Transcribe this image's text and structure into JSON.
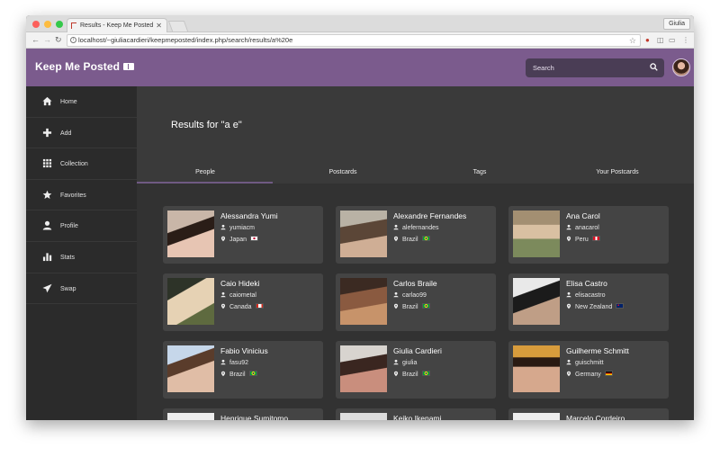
{
  "browser": {
    "tab_title": "Results - Keep Me Posted",
    "url": "localhost/~giuliacardieri/keepmeposted/index.php/search/results/a%20e",
    "profile_name": "Giulia"
  },
  "app": {
    "brand": "Keep Me Posted",
    "search_placeholder": "Search",
    "accent_color": "#7b5b8d"
  },
  "sidebar": {
    "items": [
      {
        "label": "Home",
        "icon": "home-icon"
      },
      {
        "label": "Add",
        "icon": "plus-icon"
      },
      {
        "label": "Collection",
        "icon": "grid-icon"
      },
      {
        "label": "Favorites",
        "icon": "star-icon"
      },
      {
        "label": "Profile",
        "icon": "user-icon"
      },
      {
        "label": "Stats",
        "icon": "bar-chart-icon"
      },
      {
        "label": "Swap",
        "icon": "send-icon"
      }
    ]
  },
  "results": {
    "title": "Results for \"a e\"",
    "tabs": [
      "People",
      "Postcards",
      "Tags",
      "Your Postcards"
    ],
    "active_tab": "People",
    "people": [
      {
        "name": "Alessandra Yumi",
        "username": "yumiacm",
        "country": "Japan",
        "flag": "japan"
      },
      {
        "name": "Alexandre Fernandes",
        "username": "alefernandes",
        "country": "Brazil",
        "flag": "brazil"
      },
      {
        "name": "Ana Carol",
        "username": "anacarol",
        "country": "Peru",
        "flag": "peru"
      },
      {
        "name": "Caio Hideki",
        "username": "caiometal",
        "country": "Canada",
        "flag": "canada"
      },
      {
        "name": "Carlos Braile",
        "username": "carlao99",
        "country": "Brazil",
        "flag": "brazil"
      },
      {
        "name": "Elisa Castro",
        "username": "elisacastro",
        "country": "New Zealand",
        "flag": "newzealand"
      },
      {
        "name": "Fabio Vinicius",
        "username": "fasu92",
        "country": "Brazil",
        "flag": "brazil"
      },
      {
        "name": "Giulia Cardieri",
        "username": "giulia",
        "country": "Brazil",
        "flag": "brazil"
      },
      {
        "name": "Guilherme Schmitt",
        "username": "guischmitt",
        "country": "Germany",
        "flag": "germany"
      },
      {
        "name": "Henrique Sumitomo",
        "username": "",
        "country": "",
        "flag": ""
      },
      {
        "name": "Keiko Ikenami",
        "username": "",
        "country": "",
        "flag": ""
      },
      {
        "name": "Marcelo Cordeiro",
        "username": "",
        "country": "",
        "flag": ""
      }
    ]
  }
}
